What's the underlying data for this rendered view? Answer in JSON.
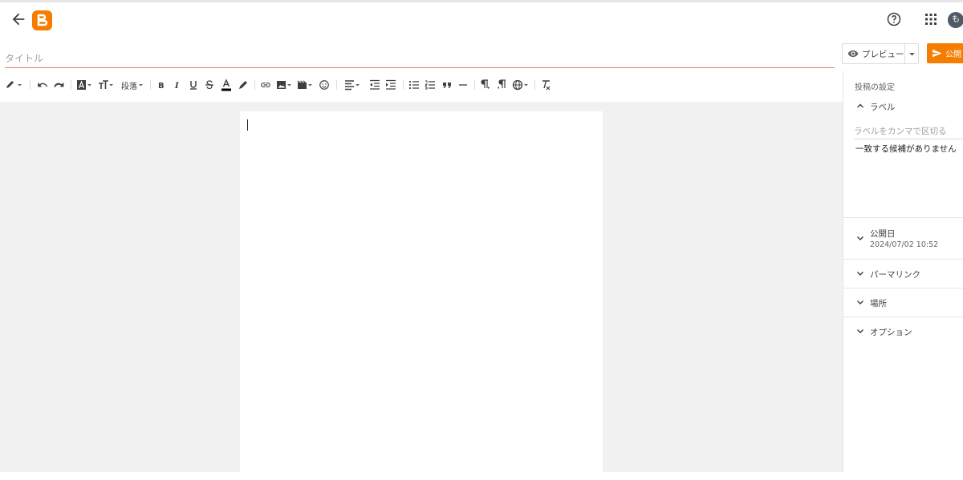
{
  "header": {
    "back_icon": "arrow-left-icon",
    "logo_icon": "blogger-logo-icon",
    "help_icon": "help-circle-icon",
    "apps_icon": "apps-grid-icon",
    "avatar_initial": "も",
    "brand_color": "#f57d00"
  },
  "editor": {
    "title_placeholder": "タイトル",
    "title_value": "",
    "accent_underline": "#f0776a"
  },
  "actions": {
    "preview_label": "プレビュー",
    "preview_icon": "eye-icon",
    "publish_label": "公開",
    "publish_icon": "send-icon"
  },
  "toolbar": {
    "paragraph_label": "段落",
    "items": [
      "pencil-mode",
      "undo",
      "redo",
      "font-family",
      "font-size",
      "paragraph",
      "bold",
      "italic",
      "underline",
      "strikethrough",
      "text-color",
      "highlight",
      "link",
      "image",
      "video",
      "emoji",
      "align",
      "indent-decrease",
      "indent-increase",
      "bulleted-list",
      "numbered-list",
      "quote",
      "horizontal-rule",
      "ltr",
      "rtl",
      "language",
      "clear-formatting"
    ]
  },
  "sidebar": {
    "heading": "投稿の設定",
    "labels_title": "ラベル",
    "labels_placeholder": "ラベルをカンマで区切る",
    "labels_empty": "一致する候補がありません",
    "publish_date_title": "公開日",
    "publish_date_value": "2024/07/02 10:52",
    "permalink_title": "パーマリンク",
    "location_title": "場所",
    "options_title": "オプション"
  }
}
